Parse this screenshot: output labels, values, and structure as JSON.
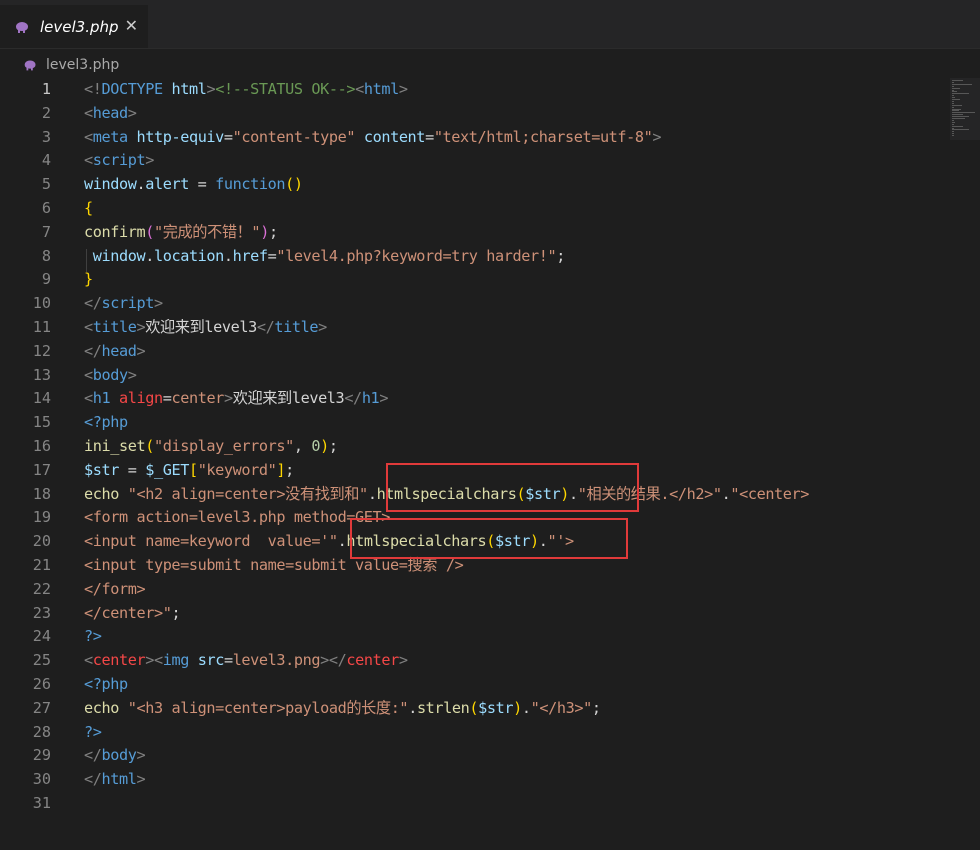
{
  "tab": {
    "title": "level3.php",
    "close_glyph": "✕",
    "icon": "php-elephant-icon"
  },
  "breadcrumb": {
    "file": "level3.php",
    "icon": "php-elephant-icon"
  },
  "active_line": 1,
  "lines": [
    [
      [
        "d",
        "<!"
      ],
      [
        "t",
        "DOCTYPE"
      ],
      [
        "p",
        " "
      ],
      [
        "a",
        "html"
      ],
      [
        "d",
        ">"
      ],
      [
        "c",
        "<!--STATUS OK-->"
      ],
      [
        "d",
        "<"
      ],
      [
        "t",
        "html"
      ],
      [
        "d",
        ">"
      ]
    ],
    [
      [
        "d",
        "<"
      ],
      [
        "t",
        "head"
      ],
      [
        "d",
        ">"
      ]
    ],
    [
      [
        "d",
        "<"
      ],
      [
        "t",
        "meta"
      ],
      [
        "p",
        " "
      ],
      [
        "a",
        "http-equiv"
      ],
      [
        "p",
        "="
      ],
      [
        "s",
        "\"content-type\""
      ],
      [
        "p",
        " "
      ],
      [
        "a",
        "content"
      ],
      [
        "p",
        "="
      ],
      [
        "s",
        "\"text/html;charset=utf-8\""
      ],
      [
        "d",
        ">"
      ]
    ],
    [
      [
        "d",
        "<"
      ],
      [
        "t",
        "script"
      ],
      [
        "d",
        ">"
      ]
    ],
    [
      [
        "v",
        "window"
      ],
      [
        "p",
        "."
      ],
      [
        "v",
        "alert"
      ],
      [
        "p",
        " = "
      ],
      [
        "k",
        "function"
      ],
      [
        "y",
        "()"
      ]
    ],
    [
      [
        "y",
        "{"
      ]
    ],
    [
      [
        "f",
        "confirm"
      ],
      [
        "m",
        "("
      ],
      [
        "s",
        "\"完成的不错！\""
      ],
      [
        "m",
        ")"
      ],
      [
        "p",
        ";"
      ]
    ],
    [
      [
        "p",
        " "
      ],
      [
        "v",
        "window"
      ],
      [
        "p",
        "."
      ],
      [
        "v",
        "location"
      ],
      [
        "p",
        "."
      ],
      [
        "v",
        "href"
      ],
      [
        "p",
        "="
      ],
      [
        "s",
        "\"level4.php?keyword=try harder!\""
      ],
      [
        "p",
        ";"
      ]
    ],
    [
      [
        "y",
        "}"
      ]
    ],
    [
      [
        "d",
        "</"
      ],
      [
        "t",
        "script"
      ],
      [
        "d",
        ">"
      ]
    ],
    [
      [
        "d",
        "<"
      ],
      [
        "t",
        "title"
      ],
      [
        "d",
        ">"
      ],
      [
        "w",
        "欢迎来到level3"
      ],
      [
        "d",
        "</"
      ],
      [
        "t",
        "title"
      ],
      [
        "d",
        ">"
      ]
    ],
    [
      [
        "d",
        "</"
      ],
      [
        "t",
        "head"
      ],
      [
        "d",
        ">"
      ]
    ],
    [
      [
        "d",
        "<"
      ],
      [
        "t",
        "body"
      ],
      [
        "d",
        ">"
      ]
    ],
    [
      [
        "d",
        "<"
      ],
      [
        "t",
        "h1"
      ],
      [
        "p",
        " "
      ],
      [
        "r",
        "align"
      ],
      [
        "p",
        "="
      ],
      [
        "s",
        "center"
      ],
      [
        "d",
        ">"
      ],
      [
        "w",
        "欢迎来到level3"
      ],
      [
        "d",
        "</"
      ],
      [
        "t",
        "h1"
      ],
      [
        "d",
        ">"
      ]
    ],
    [
      [
        "t",
        "<?php"
      ]
    ],
    [
      [
        "f",
        "ini_set"
      ],
      [
        "y",
        "("
      ],
      [
        "s",
        "\"display_errors\""
      ],
      [
        "p",
        ", "
      ],
      [
        "n",
        "0"
      ],
      [
        "y",
        ")"
      ],
      [
        "p",
        ";"
      ]
    ],
    [
      [
        "v",
        "$str"
      ],
      [
        "p",
        " = "
      ],
      [
        "v",
        "$_GET"
      ],
      [
        "y",
        "["
      ],
      [
        "s",
        "\"keyword\""
      ],
      [
        "y",
        "]"
      ],
      [
        "p",
        ";"
      ]
    ],
    [
      [
        "f",
        "echo"
      ],
      [
        "p",
        " "
      ],
      [
        "s",
        "\"<h2 align=center>没有找到和\""
      ],
      [
        "p",
        "."
      ],
      [
        "f",
        "htmlspecialchars"
      ],
      [
        "y",
        "("
      ],
      [
        "v",
        "$str"
      ],
      [
        "y",
        ")"
      ],
      [
        "p",
        "."
      ],
      [
        "s",
        "\"相关的结果.</h2>\""
      ],
      [
        "p",
        "."
      ],
      [
        "s",
        "\"<center>"
      ]
    ],
    [
      [
        "s",
        "<form action=level3.php method=GET>"
      ]
    ],
    [
      [
        "s",
        "<input name=keyword  value='\""
      ],
      [
        "p",
        "."
      ],
      [
        "f",
        "htmlspecialchars"
      ],
      [
        "y",
        "("
      ],
      [
        "v",
        "$str"
      ],
      [
        "y",
        ")"
      ],
      [
        "p",
        "."
      ],
      [
        "s",
        "\"'>"
      ]
    ],
    [
      [
        "s",
        "<input type=submit name=submit value=搜索 />"
      ]
    ],
    [
      [
        "s",
        "</form>"
      ]
    ],
    [
      [
        "s",
        "</center>\""
      ],
      [
        "p",
        ";"
      ]
    ],
    [
      [
        "t",
        "?>"
      ]
    ],
    [
      [
        "d",
        "<"
      ],
      [
        "r",
        "center"
      ],
      [
        "d",
        "><"
      ],
      [
        "t",
        "img"
      ],
      [
        "p",
        " "
      ],
      [
        "a",
        "src"
      ],
      [
        "p",
        "="
      ],
      [
        "s",
        "level3.png"
      ],
      [
        "d",
        "></"
      ],
      [
        "r",
        "center"
      ],
      [
        "d",
        ">"
      ]
    ],
    [
      [
        "t",
        "<?php"
      ]
    ],
    [
      [
        "f",
        "echo"
      ],
      [
        "p",
        " "
      ],
      [
        "s",
        "\"<h3 align=center>payload的长度:\""
      ],
      [
        "p",
        "."
      ],
      [
        "f",
        "strlen"
      ],
      [
        "y",
        "("
      ],
      [
        "v",
        "$str"
      ],
      [
        "y",
        ")"
      ],
      [
        "p",
        "."
      ],
      [
        "s",
        "\"</h3>\""
      ],
      [
        "p",
        ";"
      ]
    ],
    [
      [
        "t",
        "?>"
      ]
    ],
    [
      [
        "d",
        "</"
      ],
      [
        "t",
        "body"
      ],
      [
        "d",
        ">"
      ]
    ],
    [
      [
        "d",
        "</"
      ],
      [
        "t",
        "html"
      ],
      [
        "d",
        ">"
      ]
    ],
    []
  ],
  "annotations": [
    "red-highlight-box-line-18",
    "red-highlight-box-line-20"
  ]
}
